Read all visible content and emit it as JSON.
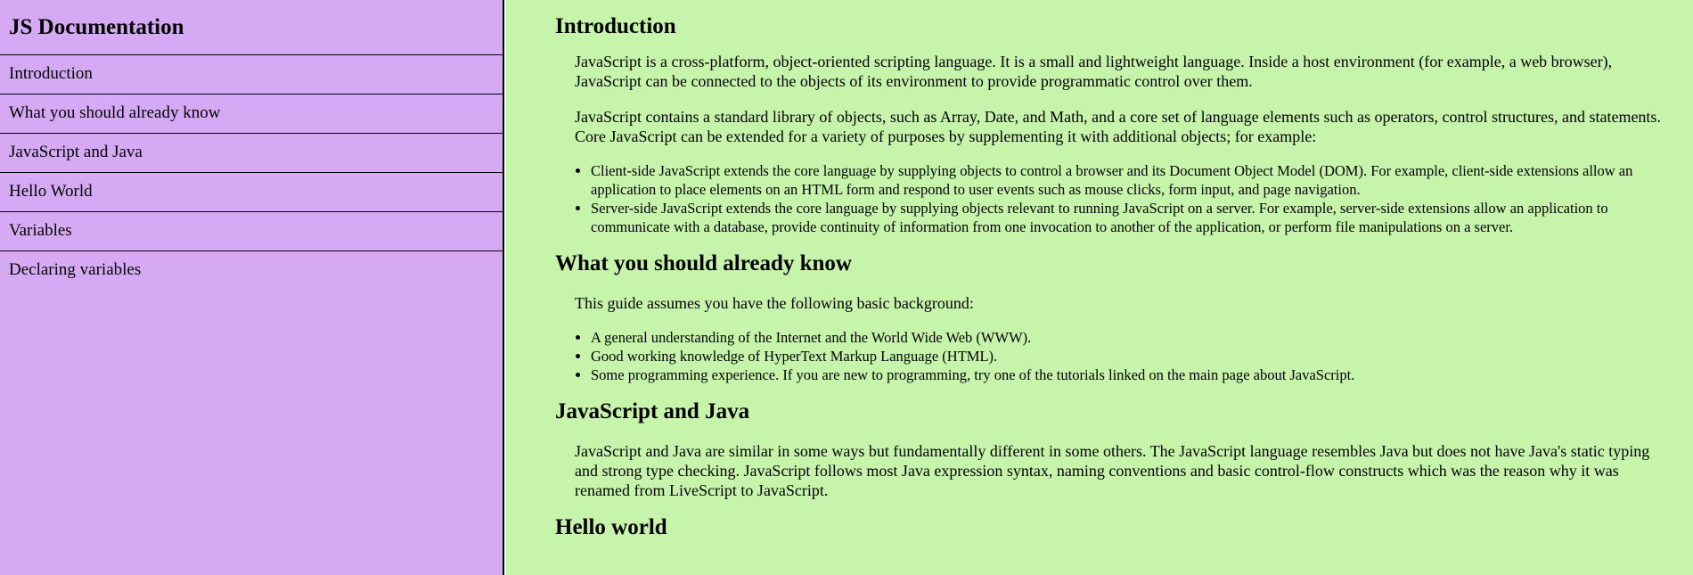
{
  "sidebar": {
    "title": "JS Documentation",
    "items": [
      {
        "label": "Introduction"
      },
      {
        "label": "What you should already know"
      },
      {
        "label": "JavaScript and Java"
      },
      {
        "label": "Hello World"
      },
      {
        "label": "Variables"
      },
      {
        "label": "Declaring variables"
      }
    ]
  },
  "main": {
    "sections": [
      {
        "title": "Introduction",
        "paragraphs": [
          "JavaScript is a cross-platform, object-oriented scripting language. It is a small and lightweight language. Inside a host environment (for example, a web browser), JavaScript can be connected to the objects of its environment to provide programmatic control over them.",
          "JavaScript contains a standard library of objects, such as Array, Date, and Math, and a core set of language elements such as operators, control structures, and statements. Core JavaScript can be extended for a variety of purposes by supplementing it with additional objects; for example:"
        ],
        "bullets": [
          "Client-side JavaScript extends the core language by supplying objects to control a browser and its Document Object Model (DOM). For example, client-side extensions allow an application to place elements on an HTML form and respond to user events such as mouse clicks, form input, and page navigation.",
          "Server-side JavaScript extends the core language by supplying objects relevant to running JavaScript on a server. For example, server-side extensions allow an application to communicate with a database, provide continuity of information from one invocation to another of the application, or perform file manipulations on a server."
        ]
      },
      {
        "title": "What you should already know",
        "paragraphs": [
          "This guide assumes you have the following basic background:"
        ],
        "bullets": [
          "A general understanding of the Internet and the World Wide Web (WWW).",
          "Good working knowledge of HyperText Markup Language (HTML).",
          "Some programming experience. If you are new to programming, try one of the tutorials linked on the main page about JavaScript."
        ]
      },
      {
        "title": "JavaScript and Java",
        "paragraphs": [
          "JavaScript and Java are similar in some ways but fundamentally different in some others. The JavaScript language resembles Java but does not have Java's static typing and strong type checking. JavaScript follows most Java expression syntax, naming conventions and basic control-flow constructs which was the reason why it was renamed from LiveScript to JavaScript."
        ]
      },
      {
        "title": "Hello world"
      }
    ]
  },
  "colors": {
    "sidebar_bg": "#d5a9f3",
    "main_bg": "#c6f4ab",
    "text": "#000000"
  }
}
